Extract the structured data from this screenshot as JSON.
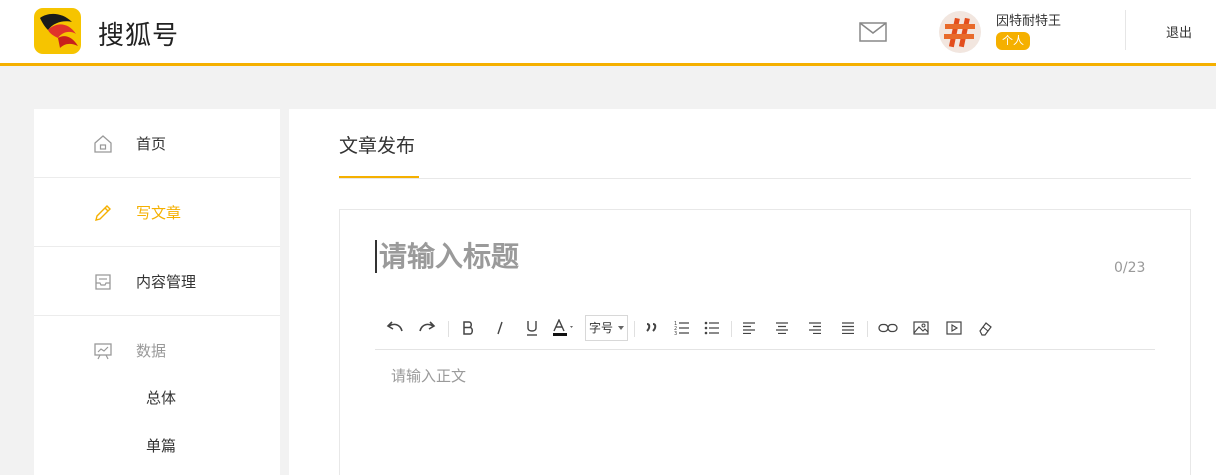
{
  "header": {
    "brand": "搜狐号",
    "username": "因特耐特王",
    "account_type": "个人",
    "logout_label": "退出"
  },
  "sidebar": {
    "items": [
      {
        "label": "首页",
        "icon": "home-icon"
      },
      {
        "label": "写文章",
        "icon": "pencil-icon",
        "active": true
      },
      {
        "label": "内容管理",
        "icon": "content-icon"
      },
      {
        "label": "数据",
        "icon": "chart-board-icon"
      }
    ],
    "sub_items": [
      {
        "label": "总体"
      },
      {
        "label": "单篇"
      }
    ]
  },
  "main": {
    "title": "文章发布",
    "title_placeholder": "请输入标题",
    "title_counter": "0/23",
    "body_placeholder": "请输入正文",
    "font_size_label": "字号"
  },
  "colors": {
    "accent": "#f5b000",
    "logo_bg": "#f6c400"
  }
}
